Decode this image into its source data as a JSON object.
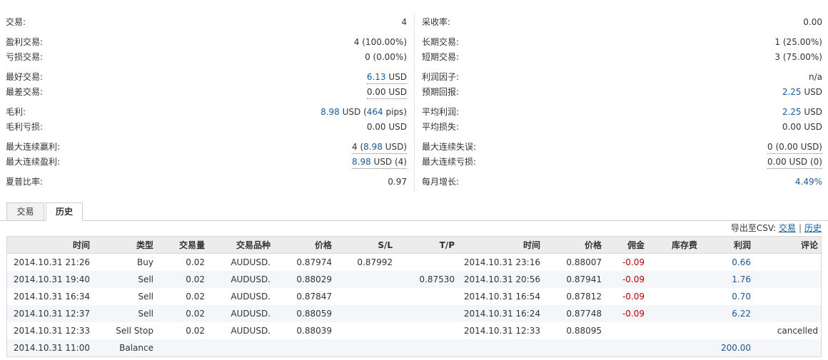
{
  "stats": {
    "left": [
      {
        "label": "交易:",
        "value": "4"
      },
      {
        "label": "盈利交易:",
        "value": "4 (100.00%)"
      },
      {
        "label": "亏损交易:",
        "value": "0 (0.00%)"
      },
      {
        "label": "最好交易:",
        "value_a": "6.13",
        "value_b": " USD"
      },
      {
        "label": "最差交易:",
        "value_a": "0.00",
        "value_b": " USD"
      },
      {
        "label": "毛利:",
        "value_a": "8.98",
        "value_b": " USD (",
        "value_c": "464",
        "value_d": " pips)"
      },
      {
        "label": "毛利亏损:",
        "value": "0.00 USD"
      },
      {
        "label": "最大连续赢利:",
        "value_a": "4 (",
        "value_b": "8.98",
        "value_c": " USD)"
      },
      {
        "label": "最大连续盈利:",
        "value_a": "8.98",
        "value_b": " USD (4)"
      },
      {
        "label": "夏普比率:",
        "value": "0.97"
      }
    ],
    "right": [
      {
        "label": "采收率:",
        "value": "0.00"
      },
      {
        "label": "长期交易:",
        "value": "1 (25.00%)"
      },
      {
        "label": "短期交易:",
        "value": "3 (75.00%)"
      },
      {
        "label": "利润因子:",
        "value": "n/a"
      },
      {
        "label": "预期回报:",
        "value_a": "2.25",
        "value_b": " USD"
      },
      {
        "label": "平均利润:",
        "value_a": "2.25",
        "value_b": " USD"
      },
      {
        "label": "平均损失:",
        "value": "0.00 USD"
      },
      {
        "label": "最大连续失误:",
        "value": "0 (0.00 USD)"
      },
      {
        "label": "最大连续亏损:",
        "value": "0.00 USD (0)"
      },
      {
        "label": "每月增长:",
        "value": "4.49%"
      }
    ]
  },
  "tabs": {
    "trade": "交易",
    "history": "历史"
  },
  "export": {
    "label": "导出至CSV: ",
    "trade_link": "交易",
    "separator": "|",
    "history_link": "历史"
  },
  "table": {
    "headers": {
      "open_time": "时间",
      "type": "类型",
      "volume": "交易量",
      "symbol": "交易品种",
      "open_price": "价格",
      "sl": "S/L",
      "tp": "T/P",
      "close_time": "时间",
      "close_price": "价格",
      "commission": "佣金",
      "swap": "库存费",
      "profit": "利润",
      "comment": "评论"
    },
    "rows": [
      {
        "open_time": "2014.10.31 21:26",
        "type": "Buy",
        "volume": "0.02",
        "symbol": "AUDUSD.",
        "open_price": "0.87974",
        "sl": "0.87992",
        "tp": "",
        "close_time": "2014.10.31 23:16",
        "close_price": "0.88007",
        "commission": "-0.09",
        "swap": "",
        "profit": "0.66",
        "comment": ""
      },
      {
        "open_time": "2014.10.31 19:40",
        "type": "Sell",
        "volume": "0.02",
        "symbol": "AUDUSD.",
        "open_price": "0.88029",
        "sl": "",
        "tp": "0.87530",
        "close_time": "2014.10.31 20:56",
        "close_price": "0.87941",
        "commission": "-0.09",
        "swap": "",
        "profit": "1.76",
        "comment": ""
      },
      {
        "open_time": "2014.10.31 16:34",
        "type": "Sell",
        "volume": "0.02",
        "symbol": "AUDUSD.",
        "open_price": "0.87847",
        "sl": "",
        "tp": "",
        "close_time": "2014.10.31 16:54",
        "close_price": "0.87812",
        "commission": "-0.09",
        "swap": "",
        "profit": "0.70",
        "comment": ""
      },
      {
        "open_time": "2014.10.31 12:37",
        "type": "Sell",
        "volume": "0.02",
        "symbol": "AUDUSD.",
        "open_price": "0.88059",
        "sl": "",
        "tp": "",
        "close_time": "2014.10.31 16:24",
        "close_price": "0.87748",
        "commission": "-0.09",
        "swap": "",
        "profit": "6.22",
        "comment": ""
      },
      {
        "open_time": "2014.10.31 12:33",
        "type": "Sell Stop",
        "volume": "0.02",
        "symbol": "AUDUSD.",
        "open_price": "0.88039",
        "sl": "",
        "tp": "",
        "close_time": "2014.10.31 12:33",
        "close_price": "0.88095",
        "commission": "",
        "swap": "",
        "profit": "",
        "comment": "cancelled"
      },
      {
        "open_time": "2014.10.31 11:00",
        "type": "Balance",
        "volume": "",
        "symbol": "",
        "open_price": "",
        "sl": "",
        "tp": "",
        "close_time": "",
        "close_price": "",
        "commission": "",
        "swap": "",
        "profit": "200.00",
        "comment": ""
      }
    ]
  }
}
